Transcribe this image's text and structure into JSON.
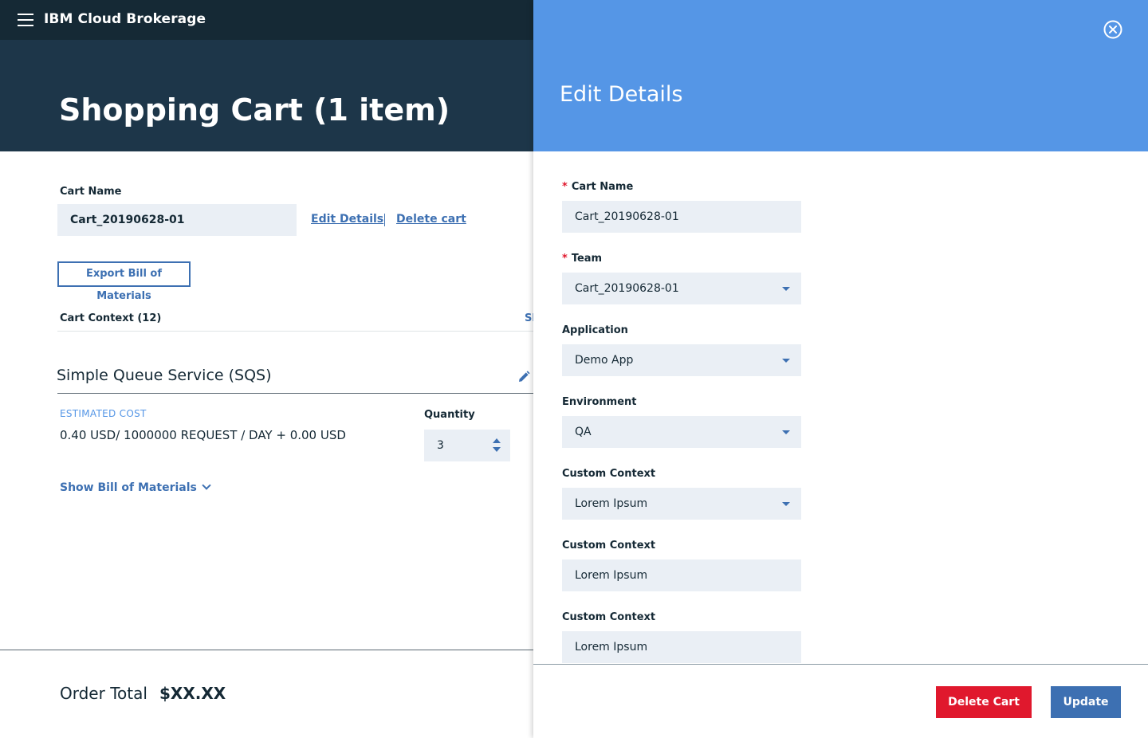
{
  "header": {
    "brand": "IBM Cloud Brokerage",
    "page_title": "Shopping Cart (1 item)"
  },
  "cart": {
    "name_label": "Cart Name",
    "name_value": "Cart_20190628-01",
    "edit_details_link": "Edit Details",
    "delete_cart_link": "Delete cart",
    "export_button": "Export Bill of Materials",
    "context_label": "Cart Context (12)",
    "context_toggle": "Sh"
  },
  "service": {
    "title": "Simple Queue Service (SQS)",
    "estimated_cost_label": "ESTIMATED COST",
    "estimated_cost_value": "0.40 USD/ 1000000 REQUEST / DAY + 0.00 USD",
    "quantity_label": "Quantity",
    "quantity_value": "3",
    "show_bom_link": "Show Bill of Materials"
  },
  "footer": {
    "order_total_label": "Order Total",
    "order_total_value": "$XX.XX"
  },
  "panel": {
    "title": "Edit Details",
    "fields": [
      {
        "label": "Cart Name",
        "value": "Cart_20190628-01",
        "required": true
      },
      {
        "label": "Team",
        "value": "Cart_20190628-01",
        "required": true
      },
      {
        "label": "Application",
        "value": "Demo App"
      },
      {
        "label": "Environment",
        "value": "QA"
      },
      {
        "label": "Custom Context",
        "value": "Lorem Ipsum"
      },
      {
        "label": "Custom Context",
        "value": "Lorem Ipsum"
      },
      {
        "label": "Custom Context",
        "value": "Lorem Ipsum"
      }
    ],
    "required_marker": "*",
    "delete_button": "Delete Cart",
    "update_button": "Update"
  },
  "icons": {
    "menu": "hamburger-icon",
    "close": "close-circle-icon",
    "edit": "pencil-icon",
    "dropdown": "caret-down-icon",
    "expand": "chevron-down-icon",
    "stepper_up": "caret-up-icon",
    "stepper_down": "caret-down-icon"
  },
  "colors": {
    "topbar": "#152935",
    "hero": "#1d3649",
    "panel_header": "#5596e6",
    "link": "#3d70b2",
    "field_bg": "#eaeff5",
    "danger": "#e0182d",
    "primary": "#3d70b2"
  }
}
